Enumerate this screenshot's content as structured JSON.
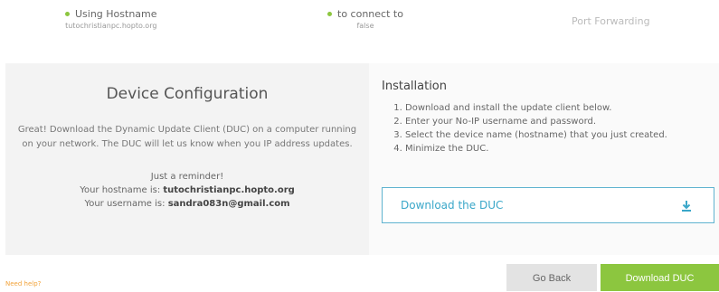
{
  "steps": [
    {
      "title": "Using Hostname",
      "sub": "tutochristianpc.hopto.org"
    },
    {
      "title": "to connect to",
      "sub": "false"
    },
    {
      "title": "Port Forwarding"
    }
  ],
  "left_panel": {
    "title": "Device Configuration",
    "description": "Great! Download the Dynamic Update Client (DUC) on a computer running on your network. The DUC will let us know when you IP address updates.",
    "reminder": "Just a reminder!",
    "hostname_prefix": "Your hostname is: ",
    "hostname": "tutochristianpc.hopto.org",
    "username_prefix": "Your username is: ",
    "username": "sandra083n@gmail.com"
  },
  "right_panel": {
    "title": "Installation",
    "steps": [
      "Download and install the update client below.",
      "Enter your No-IP username and password.",
      "Select the device name (hostname) that you just created.",
      "Minimize the DUC."
    ],
    "download_box_label": "Download the DUC",
    "download_icon": "download-icon"
  },
  "footer": {
    "need_help": "Need help?",
    "go_back": "Go Back",
    "download": "Download DUC"
  },
  "colors": {
    "accent_green": "#8cc63f",
    "accent_blue": "#3aa7c9",
    "help_orange": "#f2a33a"
  }
}
